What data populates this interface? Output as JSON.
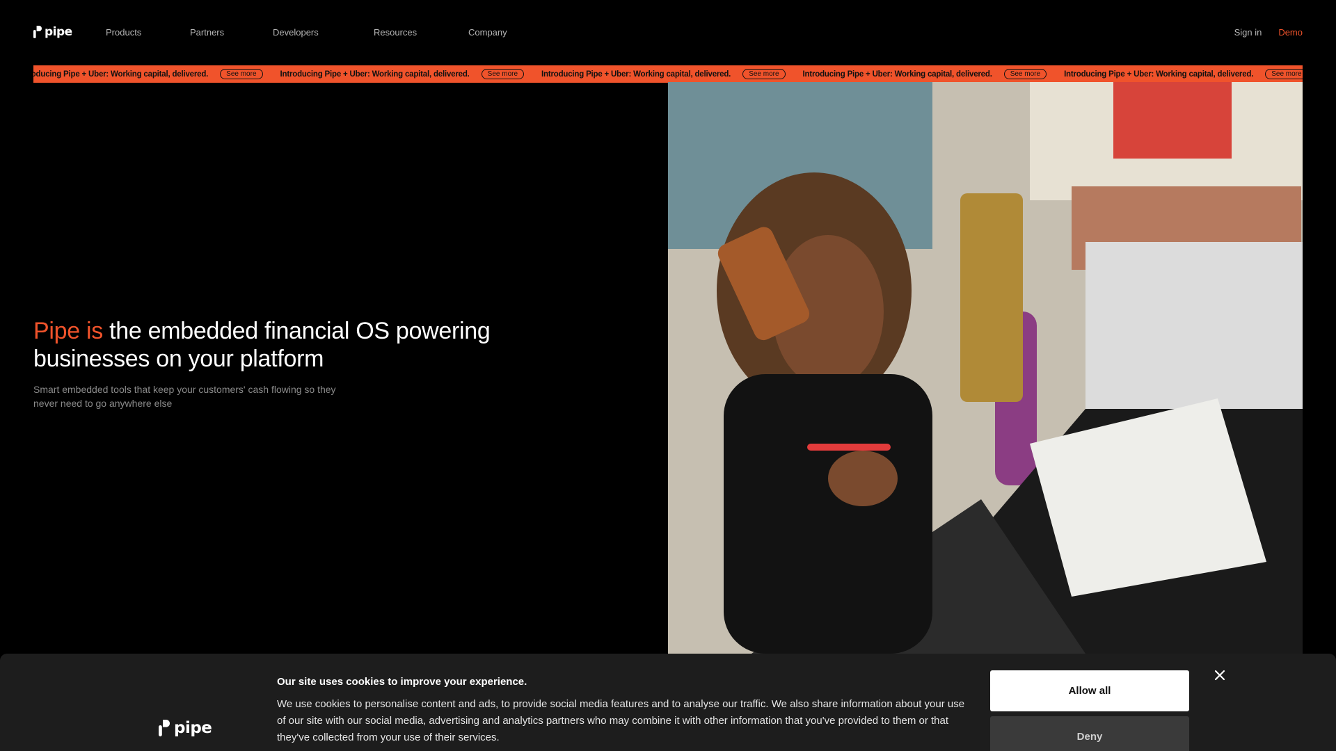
{
  "brand": {
    "name": "pipe",
    "accent_color": "#f0532b"
  },
  "nav": {
    "products": "Products",
    "partners": "Partners",
    "developers": "Developers",
    "resources": "Resources",
    "company": "Company",
    "sign_in": "Sign in",
    "demo": "Demo"
  },
  "ticker": {
    "items": [
      {
        "text": "Introducing Pipe + Uber: Working capital, delivered.",
        "button": "See more"
      },
      {
        "text": "Introducing Pipe + Uber: Working capital, delivered.",
        "button": "See more"
      },
      {
        "text": "Introducing Pipe + Uber: Working capital, delivered.",
        "button": "See more"
      },
      {
        "text": "Introducing Pipe + Uber: Working capital, delivered.",
        "button": "See more"
      },
      {
        "text": "Introducing Pipe + Uber: Working capital, delivered.",
        "button": "See more"
      }
    ]
  },
  "hero": {
    "title_accent": "Pipe is",
    "title_rest": " the embedded financial OS powering businesses on your platform",
    "subtitle": "Smart embedded tools that keep your customers' cash flowing so they never need to go anywhere else"
  },
  "cookie": {
    "title": "Our site uses cookies to improve your experience.",
    "body": "We use cookies to personalise content and ads, to provide social media features and to analyse our traffic. We also share information about your use of our site with our social media, advertising and analytics partners who may combine it with other information that you've provided to them or that they've collected from your use of their services.",
    "allow_all": "Allow all",
    "deny": "Deny"
  }
}
